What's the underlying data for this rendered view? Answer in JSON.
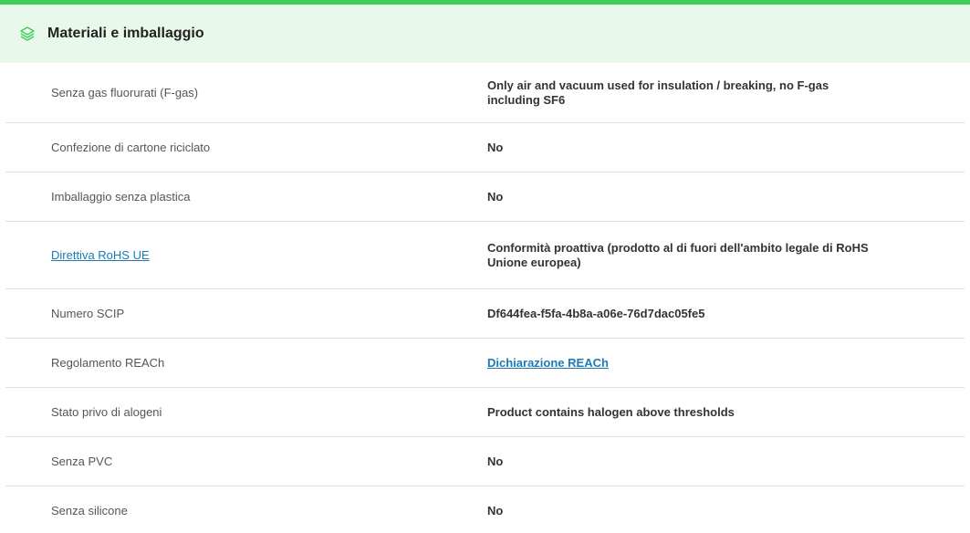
{
  "section": {
    "title": "Materiali e imballaggio",
    "icon": "layers-icon",
    "accent_color": "#3dcd58",
    "header_bg": "#e8f8ea",
    "link_color": "#1d7ab5"
  },
  "rows": [
    {
      "label": "Senza gas fluorurati (F-gas)",
      "value": "Only air and vacuum used for insulation / breaking, no F-gas including SF6"
    },
    {
      "label": "Confezione di cartone riciclato",
      "value": "No"
    },
    {
      "label": "Imballaggio senza plastica",
      "value": "No"
    },
    {
      "label": "Direttiva RoHS UE",
      "value": "Conformità proattiva (prodotto al di fuori dell'ambito legale di RoHS Unione europea)"
    },
    {
      "label": "Numero SCIP",
      "value": "Df644fea-f5fa-4b8a-a06e-76d7dac05fe5"
    },
    {
      "label": "Regolamento REACh",
      "value": "Dichiarazione REACh"
    },
    {
      "label": "Stato privo di alogeni",
      "value": "Product contains halogen above thresholds"
    },
    {
      "label": "Senza PVC",
      "value": "No"
    },
    {
      "label": "Senza silicone",
      "value": "No"
    }
  ]
}
